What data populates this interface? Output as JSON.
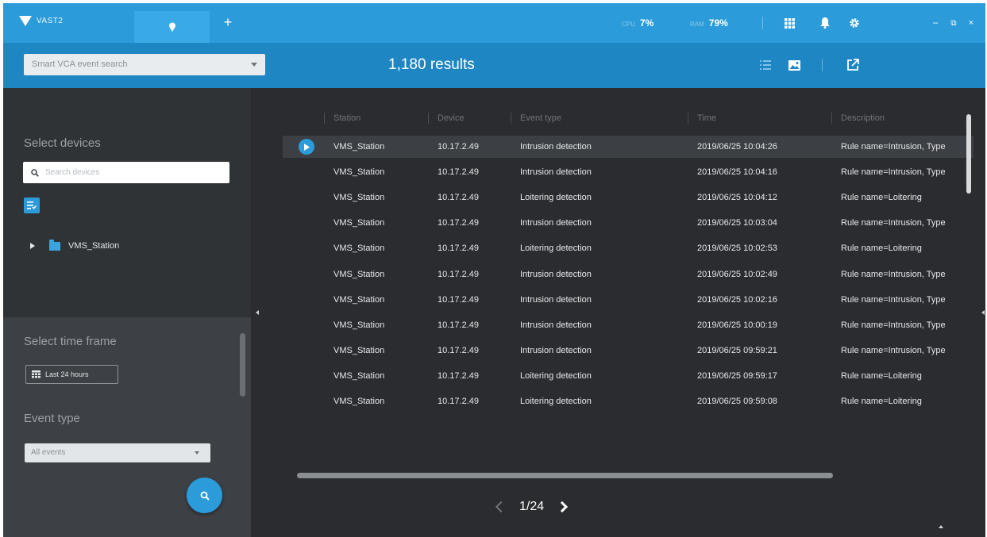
{
  "titlebar": {
    "app_name": "VAST2",
    "tab_add_symbol": "+",
    "cpu": {
      "label": "CPU",
      "value": "7%"
    },
    "ram": {
      "label": "RAM",
      "value": "79%"
    },
    "window_controls": {
      "minimize": "−",
      "restore": "⧉",
      "close": "×"
    },
    "icons": [
      "pin-icon",
      "grid-icon",
      "bell-icon",
      "gear-icon"
    ]
  },
  "toolbar": {
    "search_mode": "Smart VCA event search",
    "results_label": "1,180 results"
  },
  "left_panel": {
    "select_devices_title": "Select devices",
    "device_search_placeholder": "Search devices",
    "tree_root": "VMS_Station",
    "select_time_frame_title": "Select time frame",
    "time_frame_value": "Last 24 hours",
    "event_type_title": "Event type",
    "event_type_value": "All events"
  },
  "table": {
    "columns": [
      "Station",
      "Device",
      "Event type",
      "Time",
      "Description"
    ],
    "rows": [
      {
        "station": "VMS_Station",
        "device": "10.17.2.49",
        "event_type": "Intrusion detection",
        "time": "2019/06/25 10:04:26",
        "description": "Rule name=Intrusion, Type"
      },
      {
        "station": "VMS_Station",
        "device": "10.17.2.49",
        "event_type": "Intrusion detection",
        "time": "2019/06/25 10:04:16",
        "description": "Rule name=Intrusion, Type"
      },
      {
        "station": "VMS_Station",
        "device": "10.17.2.49",
        "event_type": "Loitering detection",
        "time": "2019/06/25 10:04:12",
        "description": "Rule name=Loitering"
      },
      {
        "station": "VMS_Station",
        "device": "10.17.2.49",
        "event_type": "Intrusion detection",
        "time": "2019/06/25 10:03:04",
        "description": "Rule name=Intrusion, Type"
      },
      {
        "station": "VMS_Station",
        "device": "10.17.2.49",
        "event_type": "Loitering detection",
        "time": "2019/06/25 10:02:53",
        "description": "Rule name=Loitering"
      },
      {
        "station": "VMS_Station",
        "device": "10.17.2.49",
        "event_type": "Intrusion detection",
        "time": "2019/06/25 10:02:49",
        "description": "Rule name=Intrusion, Type"
      },
      {
        "station": "VMS_Station",
        "device": "10.17.2.49",
        "event_type": "Intrusion detection",
        "time": "2019/06/25 10:02:16",
        "description": "Rule name=Intrusion, Type"
      },
      {
        "station": "VMS_Station",
        "device": "10.17.2.49",
        "event_type": "Intrusion detection",
        "time": "2019/06/25 10:00:19",
        "description": "Rule name=Intrusion, Type"
      },
      {
        "station": "VMS_Station",
        "device": "10.17.2.49",
        "event_type": "Intrusion detection",
        "time": "2019/06/25 09:59:21",
        "description": "Rule name=Intrusion, Type"
      },
      {
        "station": "VMS_Station",
        "device": "10.17.2.49",
        "event_type": "Loitering detection",
        "time": "2019/06/25 09:59:17",
        "description": "Rule name=Loitering"
      },
      {
        "station": "VMS_Station",
        "device": "10.17.2.49",
        "event_type": "Loitering detection",
        "time": "2019/06/25 09:59:08",
        "description": "Rule name=Loitering"
      }
    ]
  },
  "pager": {
    "page": "1/24"
  },
  "colors": {
    "accent": "#2b9bd9",
    "toolbar": "#1f86c4",
    "panel_dark": "#303336",
    "panel_mid": "#3d4044",
    "content_bg": "#2a2c2f"
  }
}
